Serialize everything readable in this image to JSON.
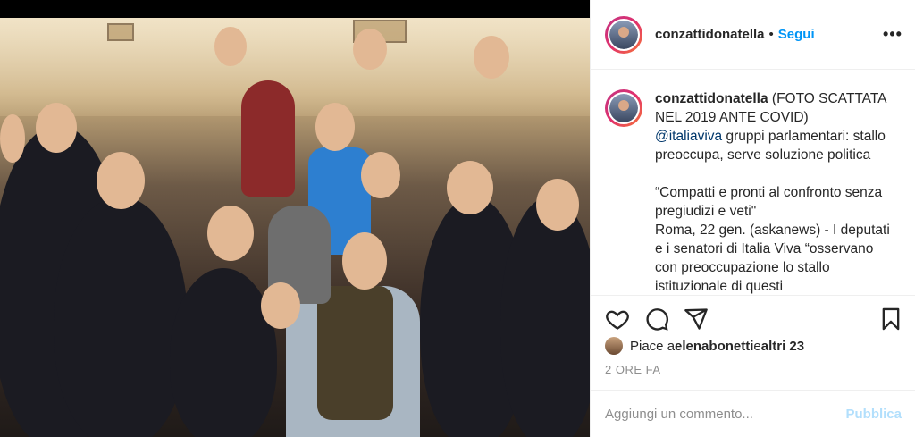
{
  "post": {
    "username": "conzattidonatella",
    "follow_label": "Segui",
    "more_icon": "more-horizontal-icon",
    "photo_alt": "Foto di gruppo"
  },
  "caption": {
    "username": "conzattidonatella",
    "line1": " (FOTO SCATTATA NEL 2019 ANTE COVID)",
    "mention": "@italiaviva",
    "body": " gruppi parlamentari: stallo preoccupa, serve soluzione politica\n\n“Compatti e pronti al confronto senza pregiudizi e veti\"\nRoma, 22 gen. (askanews) - I deputati e i senatori di Italia Viva “osservano con preoccupazione lo stallo istituzionale di questi"
  },
  "actions": {
    "like_icon": "heart-icon",
    "comment_icon": "comment-icon",
    "share_icon": "send-icon",
    "save_icon": "bookmark-icon"
  },
  "likes": {
    "prefix": "Piace a ",
    "user": "elenabonetti",
    "middle": " e ",
    "others": "altri 23"
  },
  "time_ago": "2 ORE FA",
  "comment": {
    "placeholder": "Aggiungi un commento...",
    "publish_label": "Pubblica"
  },
  "colors": {
    "accent_blue": "#0095f6",
    "publish_disabled": "#b2dffc",
    "muted": "#8e8e8e"
  }
}
